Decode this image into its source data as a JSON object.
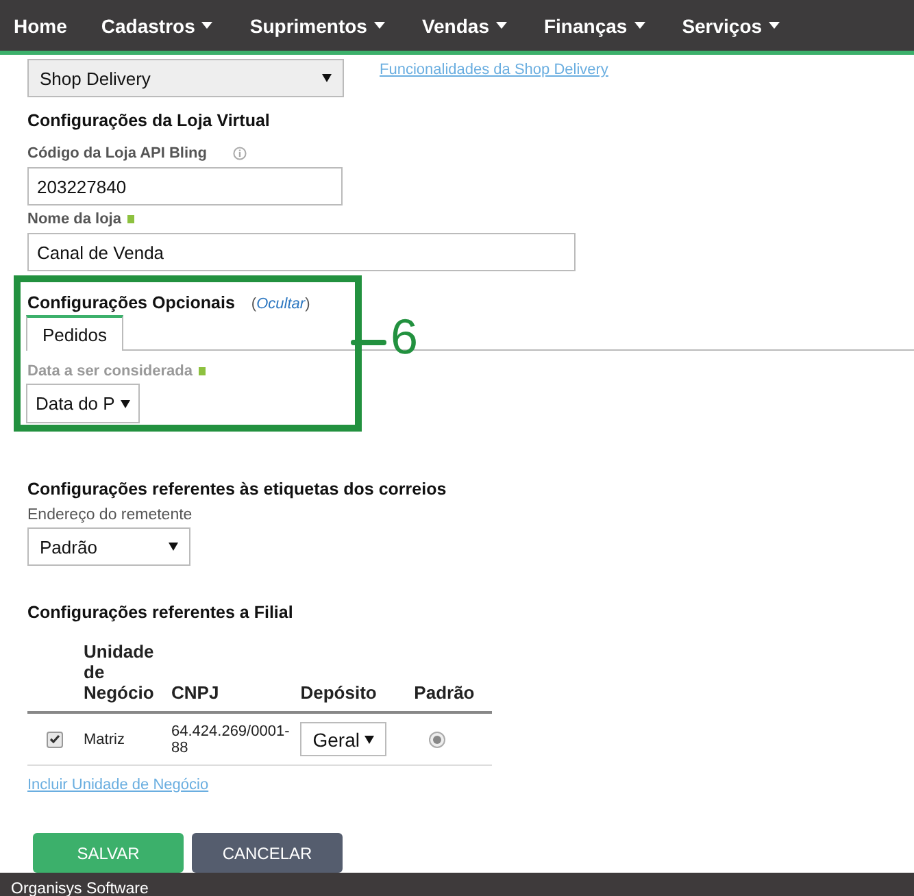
{
  "nav": {
    "items": [
      {
        "label": "Home",
        "dropdown": false
      },
      {
        "label": "Cadastros",
        "dropdown": true
      },
      {
        "label": "Suprimentos",
        "dropdown": true
      },
      {
        "label": "Vendas",
        "dropdown": true
      },
      {
        "label": "Finanças",
        "dropdown": true
      },
      {
        "label": "Serviços",
        "dropdown": true
      }
    ]
  },
  "integration": {
    "select_value": "Shop Delivery",
    "link": "Funcionalidades da Shop Delivery"
  },
  "store": {
    "heading": "Configurações da Loja Virtual",
    "code_label": "Código da Loja API Bling",
    "code_value": "203227840",
    "name_label": "Nome da loja",
    "name_required": true,
    "name_value": "Canal de Venda"
  },
  "optional": {
    "heading": "Configurações Opcionais",
    "toggle": "Ocultar",
    "toggle_brackets": [
      "(",
      ")"
    ],
    "tabs": [
      {
        "label": "Pedidos",
        "selected": true
      }
    ],
    "date_label": "Data a ser considerada",
    "date_required": true,
    "date_value": "Data do P"
  },
  "annotation": {
    "number": "6"
  },
  "labels": {
    "heading": "Configurações referentes às etiquetas dos correios",
    "sender_label": "Endereço do remetente",
    "sender_value": "Padrão"
  },
  "branch": {
    "heading": "Configurações referentes a Filial",
    "columns": [
      "Unidade de Negócio",
      "CNPJ",
      "Depósito",
      "Padrão"
    ],
    "rows": [
      {
        "checked": true,
        "unit": "Matriz",
        "cnpj": "64.424.269/0001-88",
        "deposit": "Geral",
        "selected": true
      }
    ],
    "add_link": "Incluir Unidade de Negócio"
  },
  "buttons": [
    {
      "label": "SALVAR",
      "kind": "primary"
    },
    {
      "label": "CANCELAR",
      "kind": "secondary"
    }
  ],
  "footer": "Organisys Software"
}
